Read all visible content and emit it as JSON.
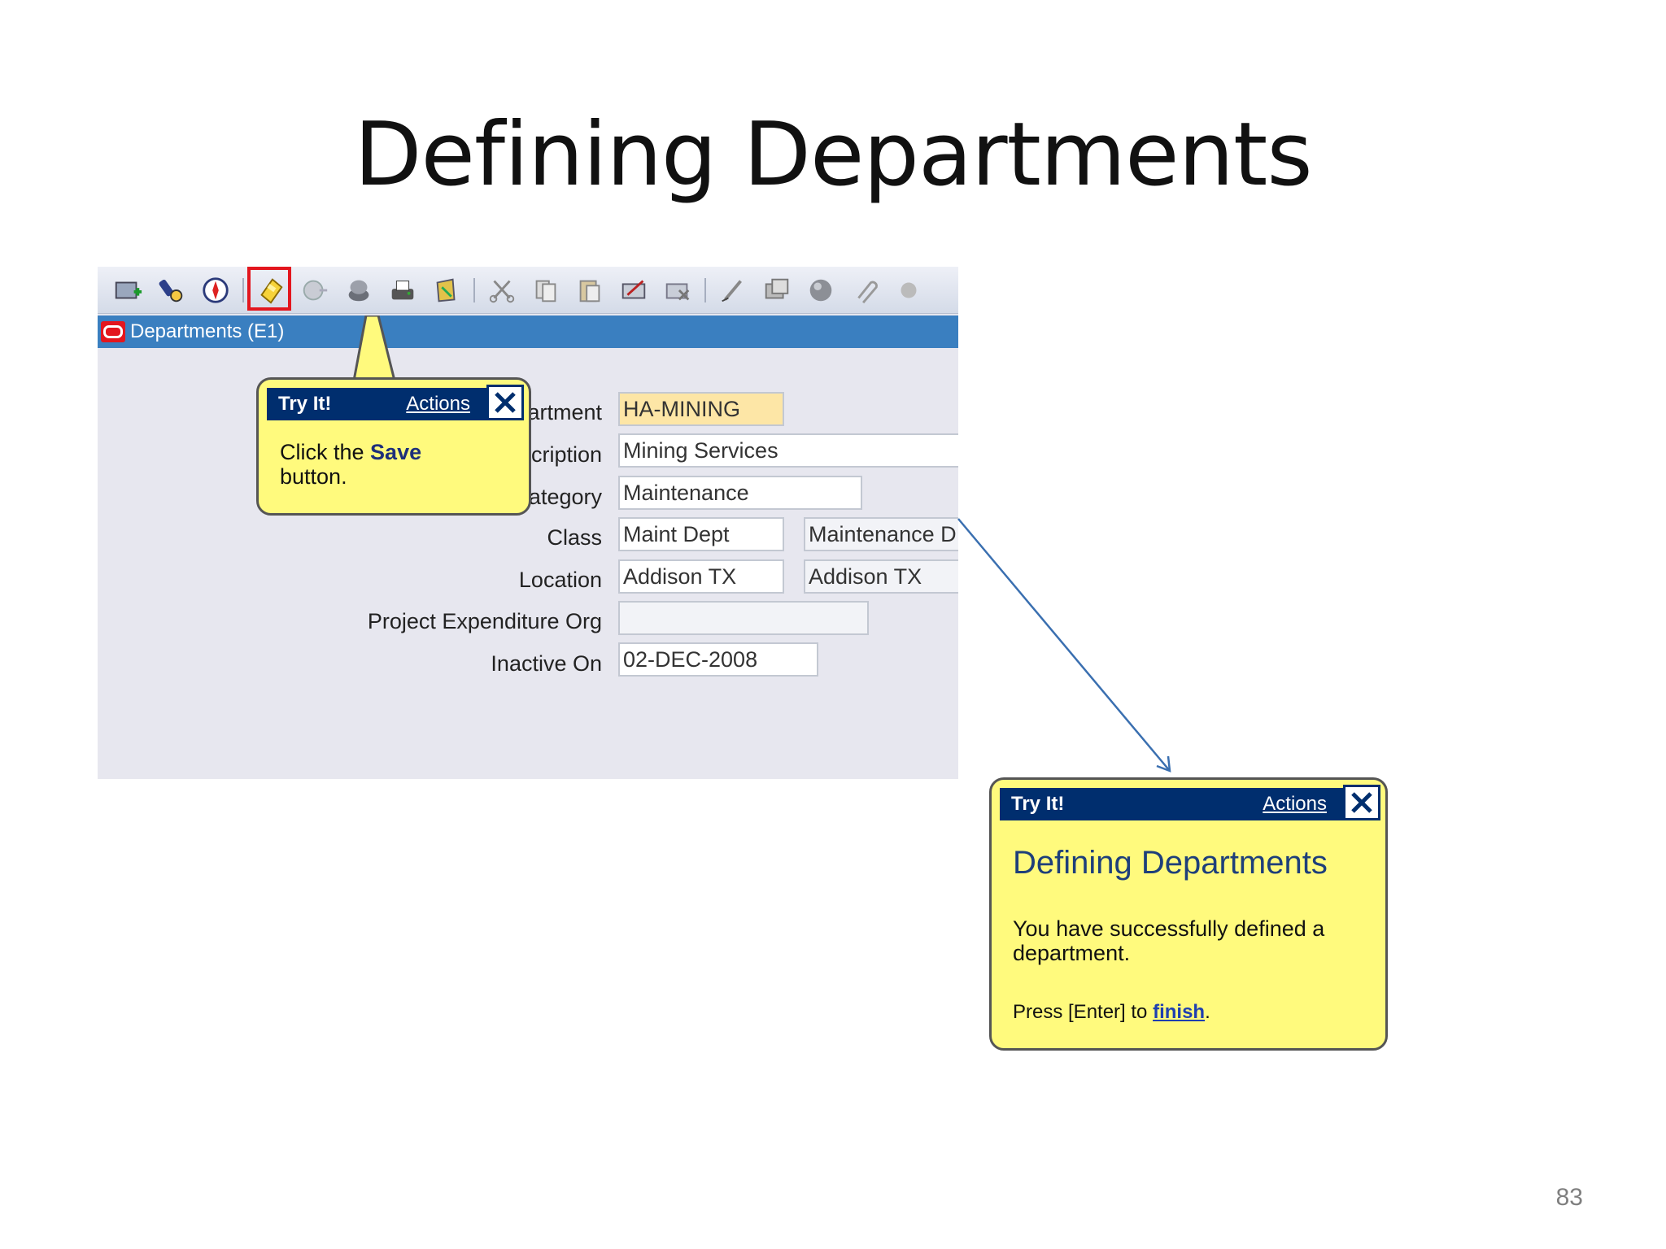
{
  "slide": {
    "title": "Defining Departments",
    "page_number": "83"
  },
  "toolbar": {
    "icons": [
      "new-icon",
      "find-icon",
      "navigator-icon",
      "save-icon",
      "next-step-icon",
      "switch-responsibility-icon",
      "print-icon",
      "close-form-icon",
      "cut-icon",
      "copy-icon",
      "paste-icon",
      "clear-record-icon",
      "delete-record-icon",
      "edit-field-icon",
      "zoom-icon",
      "translations-icon",
      "attachments-icon",
      "folder-tools-icon"
    ],
    "highlight_color": "#e3161e"
  },
  "window": {
    "title": "Departments (E1)"
  },
  "form": {
    "department_label": "Department",
    "department_value": "HA-MINING",
    "description_label": "Description",
    "description_value": "Mining Services",
    "category_label": "Category",
    "category_value": "Maintenance",
    "class_label": "Class",
    "class_value": "Maint Dept",
    "class_desc_value": "Maintenance D",
    "location_label": "Location",
    "location_value": "Addison TX",
    "location_desc_value": "Addison TX",
    "project_org_label": "Project Expenditure Org",
    "project_org_value": "",
    "inactive_label": "Inactive On",
    "inactive_value": "02-DEC-2008"
  },
  "bubble1": {
    "header": "Try It!",
    "actions": "Actions",
    "text_prefix": "Click the ",
    "text_bold": "Save",
    "text_suffix": "button."
  },
  "bubble2": {
    "header": "Try It!",
    "actions": "Actions",
    "title": "Defining Departments",
    "message": "You have successfully defined a department.",
    "press_prefix": "Press [Enter] to ",
    "press_link": "finish",
    "press_suffix": "."
  },
  "colors": {
    "bubble_bg": "#fffa7d",
    "bubble_header": "#002e6e",
    "window_bar": "#3a7fc0",
    "required_field": "#fde6a6"
  }
}
